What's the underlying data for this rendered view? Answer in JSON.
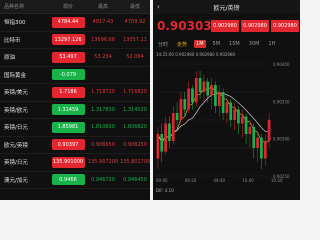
{
  "list": {
    "headers": [
      "品种名称",
      "现价",
      "最高",
      "最低"
    ],
    "rows": [
      {
        "name": "恒指300",
        "price": "4784.44",
        "high": "4817.43",
        "low": "4709.92",
        "dir": "up"
      },
      {
        "name": "比特币",
        "price": "13297.126",
        "high": "13596.66",
        "low": "13057.11",
        "dir": "up"
      },
      {
        "name": "原油",
        "price": "53.497",
        "high": "53.234",
        "low": "52.064",
        "dir": "up"
      },
      {
        "name": "国际黄金",
        "price": "-0.079",
        "high": "",
        "low": "",
        "dir": "down"
      },
      {
        "name": "英镑/美元",
        "price": "1.7186",
        "high": "1.718720",
        "low": "1.716820",
        "dir": "up"
      },
      {
        "name": "英镑/欧元",
        "price": "1.31459",
        "high": "1.317830",
        "low": "1.314520",
        "dir": "down"
      },
      {
        "name": "英镑/日元",
        "price": "1.85981",
        "high": "1.810830",
        "low": "1.806820",
        "dir": "down"
      },
      {
        "name": "欧元/英镑",
        "price": "0.90397",
        "high": "0.906650",
        "low": "0.908250",
        "dir": "up"
      },
      {
        "name": "英镑/日元",
        "price": "135.901000",
        "high": "135.907200",
        "low": "135.801700",
        "dir": "up"
      },
      {
        "name": "澳元/加元",
        "price": "0.9466",
        "high": "0.946720",
        "low": "0.946450",
        "dir": "down"
      }
    ]
  },
  "detail": {
    "back": "‹",
    "title": "欧元/英镑",
    "price": "0.90303",
    "quote_a": "0.902980",
    "quote_b": "0.902980",
    "quote_c": "0.902980",
    "tabs": [
      "分时",
      "走势",
      "1M",
      "5M",
      "15M",
      "30M",
      "1H"
    ],
    "ohlc": "14:25:00  0.902980  0.902980  0.902980",
    "dif": "DIF: 0.10",
    "price_ticks": [
      "0.90400",
      "0.90350",
      "0.90300",
      "0.90250"
    ],
    "time_ticks": [
      "09:00",
      "09:20",
      "09:40",
      "10:00",
      "10:20"
    ],
    "colors": {
      "up": "#e3262f",
      "down": "#19b34b",
      "ma1": "#f0c23c",
      "ma2": "#e8e8e8"
    }
  },
  "chart_data": {
    "type": "candlestick",
    "candles": [
      [
        0.9019,
        0.9026,
        0.9016,
        0.9028
      ],
      [
        0.9026,
        0.9021,
        0.9018,
        0.9029
      ],
      [
        0.9021,
        0.9029,
        0.902,
        0.9031
      ],
      [
        0.9029,
        0.9024,
        0.9022,
        0.9031
      ],
      [
        0.9024,
        0.9032,
        0.9023,
        0.9034
      ],
      [
        0.9032,
        0.903,
        0.9027,
        0.9035
      ],
      [
        0.903,
        0.9036,
        0.9029,
        0.9038
      ],
      [
        0.9036,
        0.9033,
        0.9031,
        0.9038
      ],
      [
        0.9033,
        0.9039,
        0.9032,
        0.9041
      ],
      [
        0.9039,
        0.9035,
        0.9033,
        0.904
      ],
      [
        0.9035,
        0.9042,
        0.9034,
        0.9044
      ],
      [
        0.9042,
        0.9038,
        0.9036,
        0.9044
      ],
      [
        0.9038,
        0.9041,
        0.9035,
        0.9043
      ],
      [
        0.9041,
        0.9037,
        0.9035,
        0.9042
      ],
      [
        0.9037,
        0.904,
        0.9033,
        0.9042
      ],
      [
        0.904,
        0.9034,
        0.9032,
        0.9041
      ],
      [
        0.9034,
        0.9038,
        0.9031,
        0.904
      ],
      [
        0.9038,
        0.9032,
        0.903,
        0.9039
      ],
      [
        0.9032,
        0.9035,
        0.9029,
        0.9037
      ],
      [
        0.9035,
        0.903,
        0.9028,
        0.9036
      ],
      [
        0.903,
        0.9033,
        0.9027,
        0.9035
      ],
      [
        0.9033,
        0.9029,
        0.9026,
        0.9034
      ],
      [
        0.9029,
        0.9031,
        0.9025,
        0.9033
      ],
      [
        0.9031,
        0.9026,
        0.9023,
        0.9032
      ],
      [
        0.9026,
        0.9028,
        0.9022,
        0.903
      ],
      [
        0.9028,
        0.9022,
        0.9019,
        0.9029
      ],
      [
        0.9022,
        0.9025,
        0.9018,
        0.9027
      ],
      [
        0.9025,
        0.9019,
        0.9016,
        0.9026
      ],
      [
        0.9019,
        0.9024,
        0.9017,
        0.9026
      ],
      [
        0.9024,
        0.903,
        0.9022,
        0.9032
      ]
    ]
  }
}
